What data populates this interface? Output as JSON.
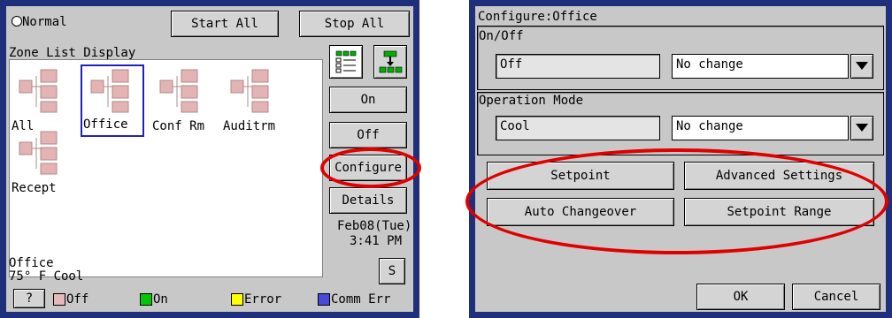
{
  "left": {
    "mode_label": "Normal",
    "start_all": "Start All",
    "stop_all": "Stop All",
    "zone_list_title": "Zone List Display",
    "zones": [
      {
        "name": "All"
      },
      {
        "name": "Office"
      },
      {
        "name": "Conf Rm"
      },
      {
        "name": "Auditrm"
      },
      {
        "name": "Recept"
      }
    ],
    "right_buttons": {
      "on": "On",
      "off": "Off",
      "configure": "Configure",
      "details": "Details"
    },
    "date": "Feb08(Tue)",
    "time": "3:41 PM",
    "s_button": "S",
    "status_line1": "Office",
    "status_line2": "75° F  Cool",
    "help_button": "?",
    "legend": [
      {
        "label": "Off",
        "color": "#e8b8b8"
      },
      {
        "label": "On",
        "color": "#00c800"
      },
      {
        "label": "Error",
        "color": "#ffff00"
      },
      {
        "label": "Comm Err",
        "color": "#4a4ad8"
      }
    ]
  },
  "right": {
    "title": "Configure:Office",
    "onoff_group": "On/Off",
    "onoff_current": "Off",
    "onoff_select": "No change",
    "opmode_group": "Operation Mode",
    "opmode_current": "Cool",
    "opmode_select": "No change",
    "buttons": {
      "setpoint": "Setpoint",
      "advanced": "Advanced Settings",
      "auto_changeover": "Auto Changeover",
      "setpoint_range": "Setpoint Range",
      "ok": "OK",
      "cancel": "Cancel"
    }
  },
  "colors": {
    "frame": "#1f2f7a",
    "panel": "#c8c8c8",
    "highlight_ring": "#e00000",
    "selected_zone": "#2020c0"
  }
}
